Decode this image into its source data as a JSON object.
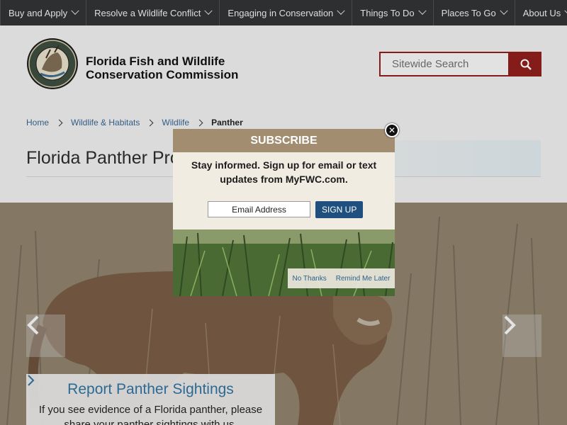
{
  "nav": {
    "items": [
      {
        "label": "Buy and Apply"
      },
      {
        "label": "Resolve a Wildlife Conflict"
      },
      {
        "label": "Engaging in Conservation"
      },
      {
        "label": "Things To Do"
      },
      {
        "label": "Places To Go"
      },
      {
        "label": "About Us"
      }
    ]
  },
  "header": {
    "org_line1": "Florida Fish and Wildlife",
    "org_line2": "Conservation Commission",
    "logo_icon": "fwc-seal-logo",
    "search_placeholder": "Sitewide Search",
    "search_icon": "search-icon"
  },
  "breadcrumb": [
    "Home",
    "Wildlife & Habitats",
    "Wildlife",
    "Panther"
  ],
  "page_title": "Florida Panther Pro",
  "hero": {
    "report_title": "Report Panther Sightings",
    "report_text_line1": "If you see evidence of a Florida panther, please",
    "report_text_line2": "share your panther sightings with us."
  },
  "modal": {
    "title": "SUBSCRIBE",
    "message_line1": "Stay informed. Sign up for email or text",
    "message_line2": "updates from MyFWC.com.",
    "email_placeholder": "Email Address",
    "signup_label": "SIGN UP",
    "no_thanks": "No Thanks",
    "remind_later": "Remind Me Later",
    "close_glyph": "✕"
  },
  "colors": {
    "nav_bg": "#2f3134",
    "brand_red": "#8a1e1b",
    "link_blue": "#33628c",
    "modal_header": "#a28d70",
    "signup_blue": "#1f4f7e"
  }
}
